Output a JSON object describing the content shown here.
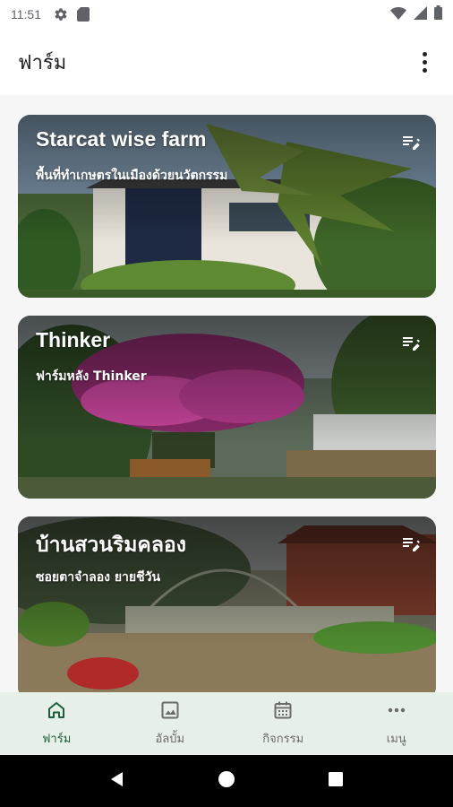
{
  "status_bar": {
    "time": "11:51",
    "icons": [
      "gear-icon",
      "sd-card-icon",
      "wifi-icon",
      "signal-icon",
      "battery-icon"
    ]
  },
  "app_bar": {
    "title": "ฟาร์ม",
    "overflow_icon": "more-vert-icon"
  },
  "farms": [
    {
      "title": "Starcat wise farm",
      "subtitle": "พื้นที่ทำเกษตรในเมืองด้วยนวัตกรรม",
      "edit_icon": "edit-note-icon"
    },
    {
      "title": "Thinker",
      "subtitle": "ฟาร์มหลัง Thinker",
      "edit_icon": "edit-note-icon"
    },
    {
      "title": "บ้านสวนริมคลอง",
      "subtitle": "ซอยตาจำลอง ยายชีวัน",
      "edit_icon": "edit-note-icon"
    }
  ],
  "bottom_nav": {
    "items": [
      {
        "label": "ฟาร์ม",
        "icon": "home-icon",
        "active": true
      },
      {
        "label": "อัลบั้ม",
        "icon": "image-icon",
        "active": false
      },
      {
        "label": "กิจกรรม",
        "icon": "calendar-icon",
        "active": false
      },
      {
        "label": "เมนู",
        "icon": "more-horiz-icon",
        "active": false
      }
    ]
  },
  "colors": {
    "nav_background": "#e6efe8",
    "nav_active": "#1b5e3b",
    "nav_inactive": "#6b6b6b"
  }
}
